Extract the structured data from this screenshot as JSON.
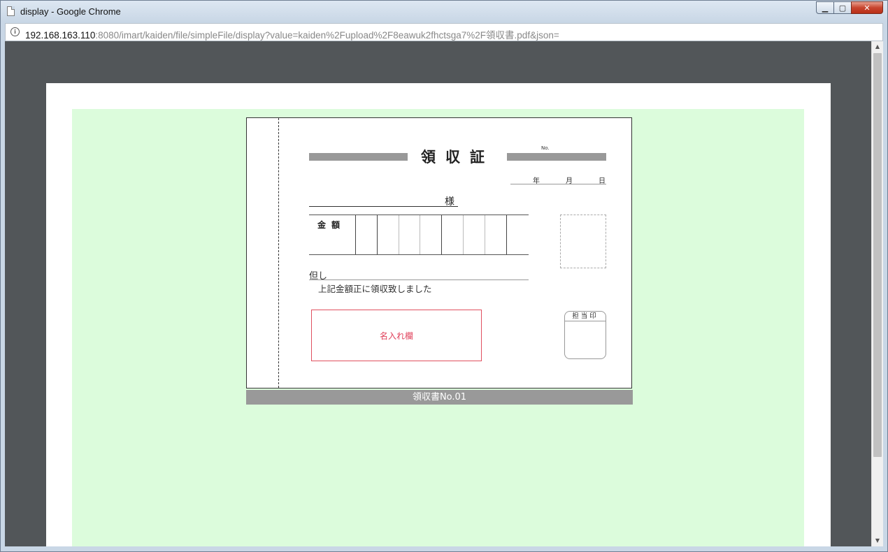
{
  "window": {
    "title": "display - Google Chrome",
    "minimize_symbol": "▁",
    "maximize_symbol": "▢",
    "close_symbol": "✕"
  },
  "address": {
    "host": "192.168.163.110",
    "path": ":8080/imart/kaiden/file/simpleFile/display?value=kaiden%2Fupload%2F8eawuk2fhctsga7%2F領収書.pdf&json="
  },
  "receipt": {
    "title": "領収証",
    "no_label": "No.",
    "date": {
      "year": "年",
      "month": "月",
      "day": "日"
    },
    "sama": "様",
    "amount_label": "金額",
    "tadashi": "但し",
    "received_text": "上記金額正に領収致しました",
    "name_box_text": "名入れ欄",
    "tanto_label": "担当印"
  },
  "caption": "領収書No.01",
  "colors": {
    "name_box": "#e0505f",
    "page_background": "#dcfcdc",
    "viewer_background": "#525659"
  }
}
